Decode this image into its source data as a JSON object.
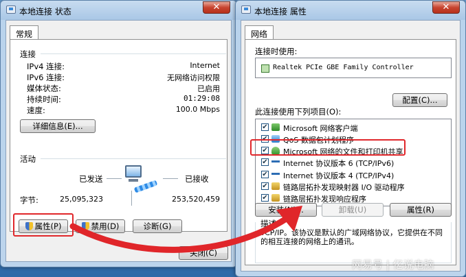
{
  "status_window": {
    "title": "本地连接 状态",
    "close_glyph": "✕",
    "tab_general": "常规",
    "section_connection": "连接",
    "rows": [
      {
        "label": "IPv4 连接:",
        "value": "Internet"
      },
      {
        "label": "IPv6 连接:",
        "value": "无网络访问权限"
      },
      {
        "label": "媒体状态:",
        "value": "已启用"
      },
      {
        "label": "持续时间:",
        "value": "01:29:08"
      },
      {
        "label": "速度:",
        "value": "100.0 Mbps"
      }
    ],
    "details_button": "详细信息(E)...",
    "section_activity": "活动",
    "sent_label": "已发送",
    "received_label": "已接收",
    "bytes_label": "字节:",
    "bytes_sent": "25,095,323",
    "bytes_received": "253,520,459",
    "properties_button": "属性(P)",
    "disable_button": "禁用(D)",
    "diagnose_button": "诊断(G)",
    "close_button": "关闭(C)"
  },
  "properties_window": {
    "title": "本地连接 属性",
    "close_glyph": "✕",
    "tab_network": "网络",
    "connect_using_label": "连接时使用:",
    "adapter_name": "Realtek PCIe GBE Family Controller",
    "configure_button": "配置(C)...",
    "items_label": "此连接使用下列项目(O):",
    "items": [
      {
        "check": "✔",
        "icon": "network-client-icon",
        "label": "Microsoft 网络客户端"
      },
      {
        "check": "✔",
        "icon": "qos-icon",
        "label": "QoS 数据包计划程序"
      },
      {
        "check": "✔",
        "icon": "file-share-icon",
        "label": "Microsoft 网络的文件和打印机共享"
      },
      {
        "check": "✔",
        "icon": "protocol-icon",
        "label": "Internet 协议版本 6 (TCP/IPv6)"
      },
      {
        "check": "✔",
        "icon": "protocol-icon",
        "label": "Internet 协议版本 4 (TCP/IPv4)"
      },
      {
        "check": "✔",
        "icon": "link-layer-icon",
        "label": "链路层拓扑发现映射器 I/O 驱动程序"
      },
      {
        "check": "✔",
        "icon": "link-layer-icon",
        "label": "链路层拓扑发现响应程序"
      }
    ],
    "install_button": "安装(N)...",
    "uninstall_button": "卸载(U)",
    "properties_button": "属性(R)",
    "description_label": "描述",
    "description_text": "TCP/IP。该协议是默认的广域网络协议，它提供在不同的相互连接的网络上的通讯。"
  },
  "watermark": "网易号 | 亿说电脑",
  "colors": {
    "highlight": "#e0262a",
    "arrow": "#e0262a"
  }
}
